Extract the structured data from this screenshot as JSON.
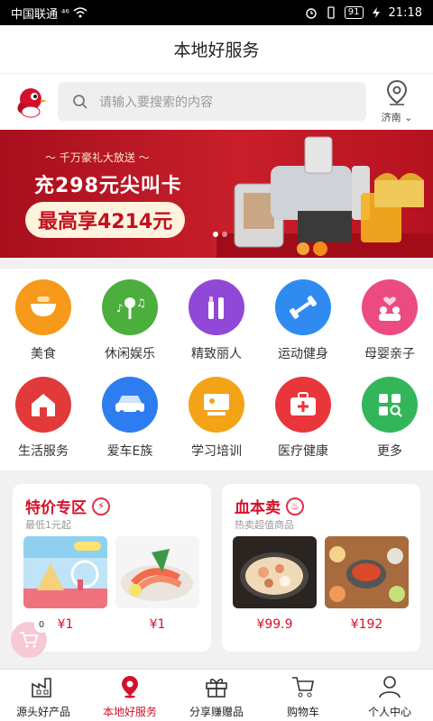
{
  "statusbar": {
    "carrier": "中国联通",
    "signal": "⁴⁶",
    "battery": "91",
    "time": "21:18"
  },
  "header": {
    "title": "本地好服务"
  },
  "search": {
    "placeholder": "请输入要搜索的内容",
    "location": "济南"
  },
  "banner": {
    "small": "～ 千万豪礼大放送 ～",
    "big": "充298元尖叫卡",
    "pill": "最高享4214元"
  },
  "categories": [
    {
      "label": "美食",
      "color": "#f59a1a",
      "icon": "bowl-icon"
    },
    {
      "label": "休闲娱乐",
      "color": "#4cae3d",
      "icon": "music-icon"
    },
    {
      "label": "精致丽人",
      "color": "#8f49d6",
      "icon": "makeup-icon"
    },
    {
      "label": "运动健身",
      "color": "#2f8bf0",
      "icon": "dumbbell-icon"
    },
    {
      "label": "母婴亲子",
      "color": "#ec4a82",
      "icon": "family-icon"
    },
    {
      "label": "生活服务",
      "color": "#e23a3a",
      "icon": "house-icon"
    },
    {
      "label": "爱车E族",
      "color": "#2d7df0",
      "icon": "car-icon"
    },
    {
      "label": "学习培训",
      "color": "#f2a316",
      "icon": "blackboard-icon"
    },
    {
      "label": "医疗健康",
      "color": "#e8363a",
      "icon": "medical-kit-icon"
    },
    {
      "label": "更多",
      "color": "#33b55a",
      "icon": "more-grid-icon"
    }
  ],
  "cards": [
    {
      "title": "特价专区",
      "subtitle": "最低1元起",
      "prices": [
        "¥1",
        "¥1"
      ]
    },
    {
      "title": "血本卖",
      "subtitle": "热卖超值商品",
      "prices": [
        "¥99.9",
        "¥192"
      ]
    }
  ],
  "floatcart": {
    "count": "0"
  },
  "tabs": [
    {
      "label": "源头好产品",
      "icon": "factory-icon"
    },
    {
      "label": "本地好服务",
      "icon": "location-pin-icon",
      "active": true
    },
    {
      "label": "分享赚赠品",
      "icon": "gift-icon"
    },
    {
      "label": "购物车",
      "icon": "cart-icon"
    },
    {
      "label": "个人中心",
      "icon": "person-icon"
    }
  ],
  "colors": {
    "accent": "#d2122b",
    "banner": "#b5121f"
  }
}
